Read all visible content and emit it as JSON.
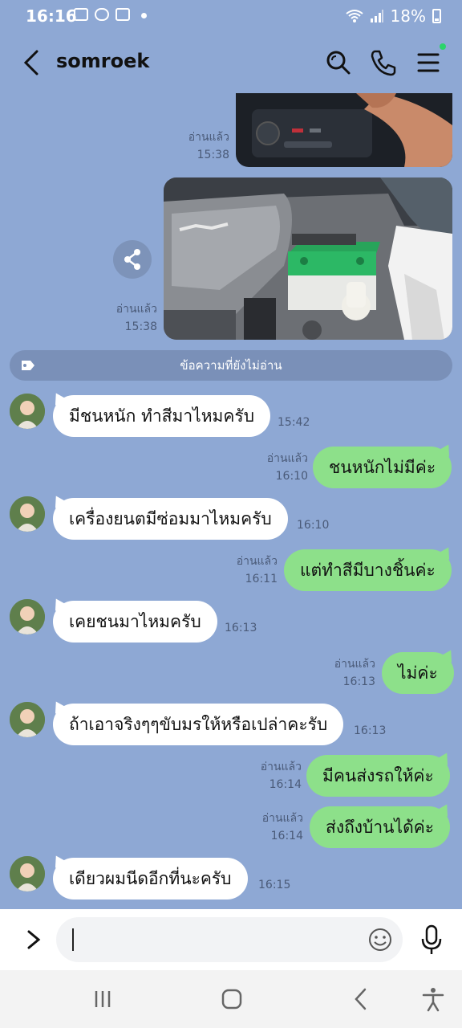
{
  "status_bar": {
    "time": "16:16",
    "battery": "18%"
  },
  "header": {
    "title": "somroek"
  },
  "photos": [
    {
      "read": "อ่านแล้ว",
      "time": "15:38"
    },
    {
      "read": "อ่านแล้ว",
      "time": "15:38"
    }
  ],
  "unread_divider": "ข้อความที่ยังไม่อ่าน",
  "messages": [
    {
      "side": "in",
      "text": "มีชนหนัก ทำสีมาไหมครับ",
      "time": "15:42"
    },
    {
      "side": "out",
      "text": "ชนหนักไม่มีค่ะ",
      "read": "อ่านแล้ว",
      "time": "16:10"
    },
    {
      "side": "in",
      "text": "เครื่องยนตมีซ่อมมาไหมครับ",
      "time": "16:10"
    },
    {
      "side": "out",
      "text": "แต่ทำสีมีบางชิ้นค่ะ",
      "read": "อ่านแล้ว",
      "time": "16:11"
    },
    {
      "side": "in",
      "text": "เคยชนมาไหมครับ",
      "time": "16:13"
    },
    {
      "side": "out",
      "text": "ไม่ค่ะ",
      "read": "อ่านแล้ว",
      "time": "16:13"
    },
    {
      "side": "in",
      "text": "ถ้าเอาจริงๆๆขับมรให้หรือเปล่าคะรับ",
      "time": "16:13"
    },
    {
      "side": "out",
      "text": "มีคนส่งรถให้ค่ะ",
      "read": "อ่านแล้ว",
      "time": "16:14"
    },
    {
      "side": "out",
      "text": "ส่งถึงบ้านได้ค่ะ",
      "read": "อ่านแล้ว",
      "time": "16:14"
    },
    {
      "side": "in",
      "text": "เดียวผมนีดอีกที่นะครับ",
      "time": "16:15"
    }
  ],
  "input": {
    "placeholder": ""
  },
  "colors": {
    "chat_bg": "#8ea8d4",
    "bubble_out": "#8de08a",
    "bubble_in": "#ffffff",
    "online_dot": "#2bd46a"
  }
}
